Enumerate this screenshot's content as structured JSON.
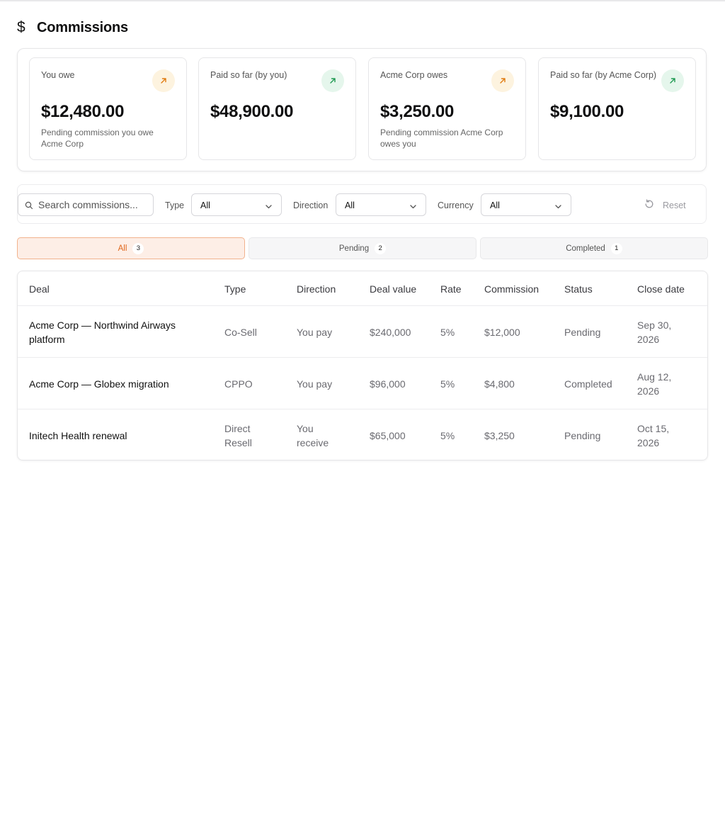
{
  "page": {
    "title": "Commissions",
    "title_icon": "dollar-icon"
  },
  "summary_cards": [
    {
      "label": "You owe",
      "amount": "$12,480.00",
      "subtitle": "Pending commission you owe Acme Corp",
      "icon": "arrow-up-right-icon",
      "accent": "#f59e0b",
      "icon_bg": "#fdf3df"
    },
    {
      "label": "Paid so far (by you)",
      "amount": "$48,900.00",
      "subtitle": "",
      "icon": "arrow-up-right-icon",
      "accent": "#22a55b",
      "icon_bg": "#e5f6ec"
    },
    {
      "label": "Acme Corp owes",
      "amount": "$3,250.00",
      "subtitle": "Pending commission Acme Corp owes you",
      "icon": "arrow-up-right-icon",
      "accent": "#f59e0b",
      "icon_bg": "#fdf3df"
    },
    {
      "label": "Paid so far (by Acme Corp)",
      "amount": "$9,100.00",
      "subtitle": "",
      "icon": "arrow-up-right-icon",
      "accent": "#22a55b",
      "icon_bg": "#e5f6ec"
    }
  ],
  "filters": {
    "search_placeholder": "Search commissions...",
    "type_label": "Type",
    "type_value": "All",
    "direction_label": "Direction",
    "direction_value": "All",
    "currency_label": "Currency",
    "currency_value": "All",
    "reset_label": "Reset"
  },
  "tabs": [
    {
      "label": "All",
      "count": "3",
      "active": true
    },
    {
      "label": "Pending",
      "count": "2",
      "active": false
    },
    {
      "label": "Completed",
      "count": "1",
      "active": false
    }
  ],
  "table": {
    "columns": [
      "Deal",
      "Type",
      "Direction",
      "Deal value",
      "Rate",
      "Commission",
      "Status",
      "Close date"
    ],
    "rows": [
      {
        "deal": "Acme Corp — Northwind Airways platform",
        "type": "Co-Sell",
        "direction": "You pay",
        "deal_value": "$240,000",
        "rate": "5%",
        "commission": "$12,000",
        "status": "Pending",
        "close_date": "Sep 30, 2026"
      },
      {
        "deal": "Acme Corp — Globex migration",
        "type": "CPPO",
        "direction": "You pay",
        "deal_value": "$96,000",
        "rate": "5%",
        "commission": "$4,800",
        "status": "Completed",
        "close_date": "Aug 12, 2026"
      },
      {
        "deal": "Initech Health renewal",
        "type": "Direct Resell",
        "direction": "You receive",
        "deal_value": "$65,000",
        "rate": "5%",
        "commission": "$3,250",
        "status": "Pending",
        "close_date": "Oct 15, 2026"
      }
    ]
  },
  "colors": {
    "accent_orange": "#e0661b",
    "active_tab_bg": "#fdeee6",
    "border": "#e6e6e8"
  }
}
